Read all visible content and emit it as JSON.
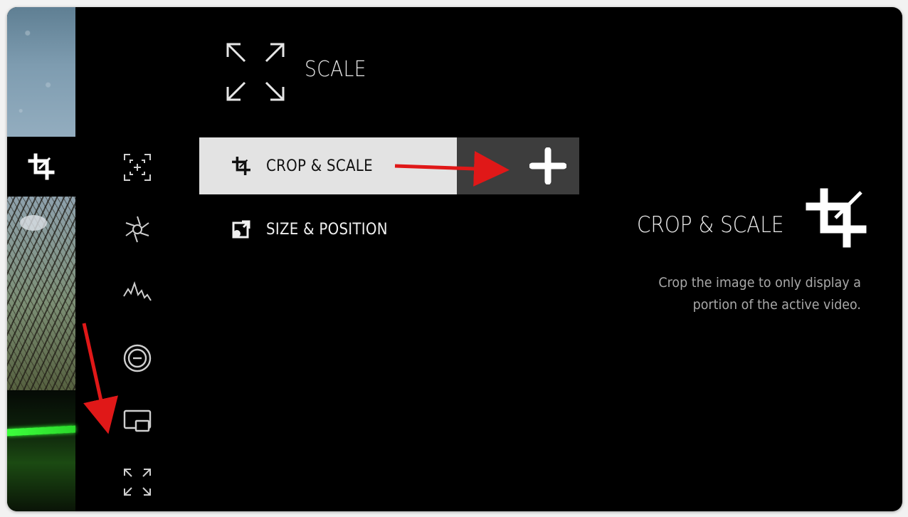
{
  "header": {
    "title": "SCALE",
    "icon": "expand-arrows-icon"
  },
  "thumbnails": [
    {
      "name": "sky",
      "icon": ""
    },
    {
      "name": "selected",
      "icon": "crop-icon"
    },
    {
      "name": "trees",
      "icon": ""
    },
    {
      "name": "green-laser",
      "icon": ""
    }
  ],
  "tools": [
    {
      "icon": "focus-assist-icon"
    },
    {
      "icon": "aperture-icon"
    },
    {
      "icon": "waveform-icon"
    },
    {
      "icon": "exposure-minus-icon"
    },
    {
      "icon": "picture-in-picture-icon"
    },
    {
      "icon": "expand-arrows-icon"
    }
  ],
  "list": {
    "items": [
      {
        "label": "CROP & SCALE",
        "icon": "crop-icon",
        "selected": true
      },
      {
        "label": "SIZE & POSITION",
        "icon": "size-position-icon",
        "selected": false
      }
    ],
    "add_icon": "plus-icon"
  },
  "detail": {
    "title": "CROP & SCALE",
    "icon": "crop-icon",
    "description": "Crop the image to only display a portion of the active video."
  },
  "colors": {
    "background": "#000000",
    "selected_row": "#e3e3e3",
    "add_button": "#3d3d3d",
    "annotation_arrow": "#e01818",
    "text": "#eaeaea",
    "muted_text": "#a9a9a9"
  }
}
